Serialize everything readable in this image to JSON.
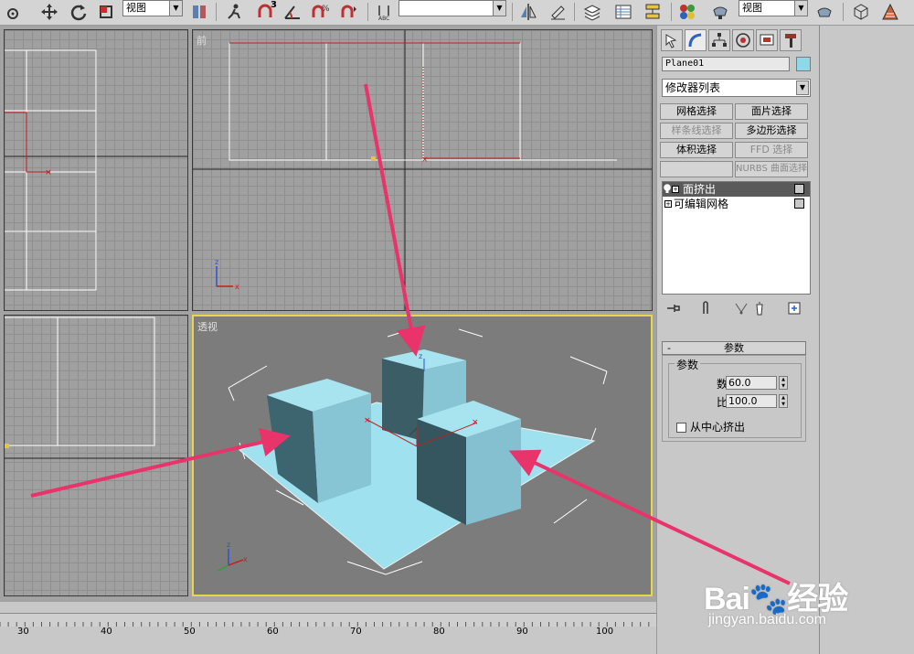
{
  "toolbar": {
    "view_select_1": "视图",
    "view_select_2": "视图",
    "select_3": "",
    "snap_label": "3"
  },
  "viewports": {
    "top_left": {
      "label": ""
    },
    "front": {
      "label": "前"
    },
    "bottom_left": {
      "label": ""
    },
    "perspective": {
      "label": "透视"
    }
  },
  "command_panel": {
    "object_name": "Plane01",
    "object_color": "#8fd8e8",
    "modifier_list": "修改器列表",
    "modifier_buttons": [
      {
        "label": "网格选择",
        "enabled": true
      },
      {
        "label": "面片选择",
        "enabled": true
      },
      {
        "label": "样条线选择",
        "enabled": false
      },
      {
        "label": "多边形选择",
        "enabled": true
      },
      {
        "label": "体积选择",
        "enabled": true
      },
      {
        "label": "FFD 选择",
        "enabled": false
      },
      {
        "label": "",
        "enabled": false
      },
      {
        "label": "NURBS 曲面选择",
        "enabled": false
      }
    ],
    "stack": [
      {
        "label": "面挤出",
        "selected": true
      },
      {
        "label": "可编辑网格",
        "selected": false
      }
    ],
    "rollout_title": "参数",
    "rollout_minus": "-",
    "param_group_title": "参数",
    "params": [
      {
        "label": "数量:",
        "value": "60.0"
      },
      {
        "label": "比例:",
        "value": "100.0"
      }
    ],
    "center_extrude": "从中心挤出"
  },
  "ruler": {
    "ticks": [
      "30",
      "40",
      "50",
      "60",
      "70",
      "80",
      "90",
      "100"
    ]
  },
  "watermark": {
    "logo": "Bai🐾经验",
    "url": "jingyan.baidu.com"
  },
  "colors": {
    "accent_arrow": "#e8336b",
    "active_viewport_border": "#e6d84a",
    "object_cyan": "#9ee0ef"
  }
}
